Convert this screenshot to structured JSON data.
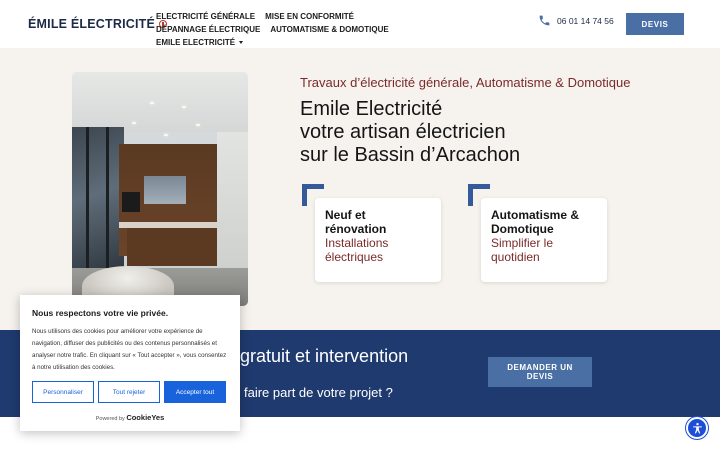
{
  "header": {
    "logo_text": "ÉMILE ÉLECTRICITÉ",
    "nav": [
      {
        "label": "ELECTRICITÉ GÉNÉRALE"
      },
      {
        "label": "MISE EN CONFORMITÉ"
      },
      {
        "label": "DÉPANNAGE ÉLECTRIQUE"
      },
      {
        "label": "AUTOMATISME & DOMOTIQUE"
      },
      {
        "label": "EMILE ELECTRICITÉ"
      }
    ],
    "phone": "06 01 14 74 56",
    "devis_label": "DEVIS"
  },
  "hero": {
    "subtitle": "Travaux d’électricité générale, Automatisme & Domotique",
    "title_lines": [
      "Emile Electricité",
      "votre artisan électricien",
      "sur le Bassin d’Arcachon"
    ],
    "cards": [
      {
        "title": "Neuf et\nrénovation",
        "subtitle": "Installations\nélectriques"
      },
      {
        "title": "Automatisme &\nDomotique",
        "subtitle": "Simplifier le\nquotidien"
      }
    ]
  },
  "band": {
    "heading": "gratuit et intervention",
    "subheading": "faire part de votre projet ?",
    "button_line1": "DEMANDER UN",
    "button_line2": "DEVIS"
  },
  "cookie": {
    "title": "Nous respectons votre vie privée.",
    "text": "Nous utilisons des cookies pour améliorer votre expérience de navigation, diffuser des publicités ou des contenus personnalisés et analyser notre trafic. En cliquant sur « Tout accepter », vous consentez à notre utilisation des cookies.",
    "customize": "Personnaliser",
    "reject": "Tout rejeter",
    "accept": "Accepter tout",
    "powered_by": "Powered by",
    "brand": "CookieYes"
  },
  "colors": {
    "navy": "#1f3a6e",
    "button_blue": "#4a6fa5",
    "accent_red": "#7a2a2a",
    "cookie_blue": "#1863dc"
  }
}
